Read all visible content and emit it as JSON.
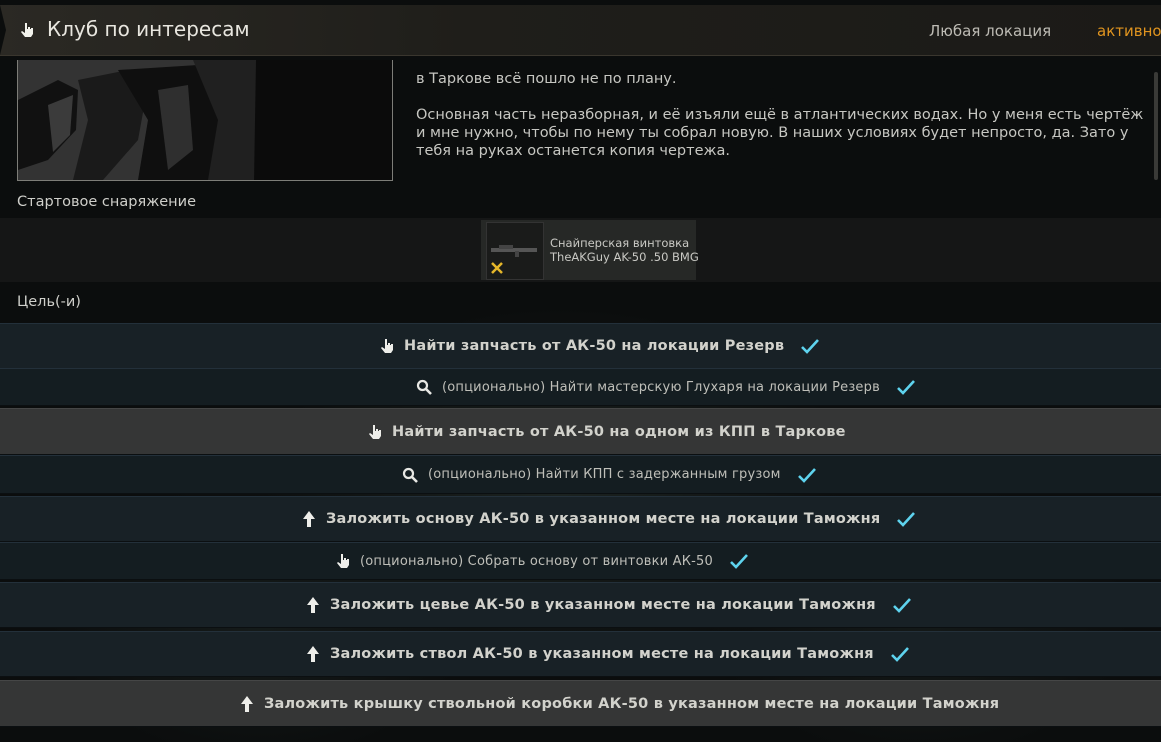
{
  "header": {
    "title": "Клуб по интересам",
    "location": "Любая локация",
    "status": "активно!"
  },
  "description": {
    "paragraphs": [
      "в Таркове всё пошло не по плану.",
      "Основная часть неразборная, и её изъяли ещё в атлантических водах. Но у меня есть чертёж и мне нужно, чтобы по нему ты собрал новую. В наших условиях будет непросто, да. Зато у тебя на руках останется копия чертежа."
    ]
  },
  "starting_gear": {
    "label": "Стартовое снаряжение",
    "item_name_line1": "Снайперская винтовка",
    "item_name_line2": "TheAKGuy AK-50 .50 BMG"
  },
  "objectives_label": "Цель(-и)",
  "objectives": [
    {
      "text": "Найти запчасть от АК-50 на локации Резерв",
      "icon": "hand-icon",
      "optional": false,
      "completed": true
    },
    {
      "text": "(опционально) Найти мастерскую Глухаря на локации Резерв",
      "icon": "search-icon",
      "optional": true,
      "completed": true
    },
    {
      "text": "Найти запчасть от АК-50 на одном из КПП в Таркове",
      "icon": "hand-icon",
      "optional": false,
      "completed": false
    },
    {
      "text": "(опционально) Найти КПП с задержанным грузом",
      "icon": "search-icon",
      "optional": true,
      "completed": true
    },
    {
      "text": "Заложить основу АК-50 в указанном месте на локации Таможня",
      "icon": "arrow-up-icon",
      "optional": false,
      "completed": true
    },
    {
      "text": "(опционально) Собрать основу от винтовки АК-50",
      "icon": "hand-icon",
      "optional": true,
      "completed": true
    },
    {
      "text": "Заложить цевье АК-50 в указанном месте на локации Таможня",
      "icon": "arrow-up-icon",
      "optional": false,
      "completed": true
    },
    {
      "text": "Заложить ствол АК-50 в указанном месте на локации Таможня",
      "icon": "arrow-up-icon",
      "optional": false,
      "completed": true
    },
    {
      "text": "Заложить крышку ствольной коробки АК-50 в указанном месте на локации Таможня",
      "icon": "arrow-up-icon",
      "optional": false,
      "completed": false
    }
  ],
  "colors": {
    "accent_status": "#e0941f",
    "check": "#5ed3ee",
    "row_bg": "#182126",
    "row_selected_bg": "#353636"
  }
}
